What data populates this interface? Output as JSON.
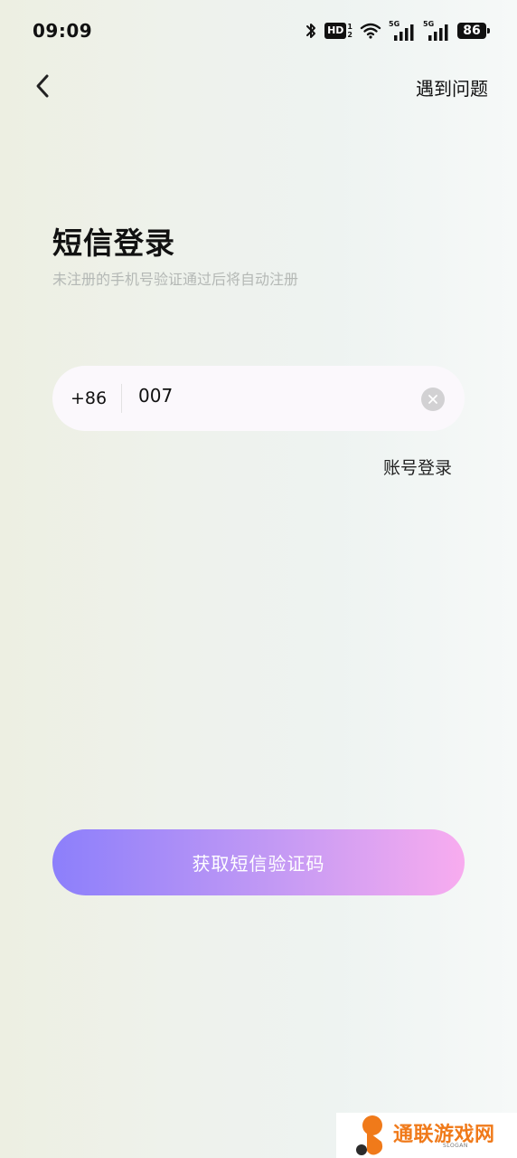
{
  "status_bar": {
    "time": "09:09",
    "hd_label": "HD",
    "hd_sub_top": "1",
    "hd_sub_bottom": "2",
    "sim1_network": "5G",
    "sim2_network": "5G",
    "battery_level": "86",
    "icons": [
      "bluetooth-icon",
      "hd-voice-icon",
      "wifi-icon",
      "signal-icon",
      "signal-icon",
      "battery-icon"
    ]
  },
  "header": {
    "back_icon": "chevron-left-icon",
    "help_label": "遇到问题"
  },
  "login": {
    "title": "短信登录",
    "subtitle": "未注册的手机号验证通过后将自动注册",
    "country_code": "+86",
    "phone_value": "007",
    "clear_icon": "clear-icon",
    "account_login_label": "账号登录",
    "get_code_label": "获取短信验证码"
  },
  "watermark": {
    "text": "通联游戏网",
    "slogan": "SLOGAN"
  },
  "colors": {
    "button_gradient_start": "#8c7ffb",
    "button_gradient_end": "#f8acef",
    "watermark_orange": "#f07a1a",
    "subtitle_gray": "#b4b8b5"
  }
}
